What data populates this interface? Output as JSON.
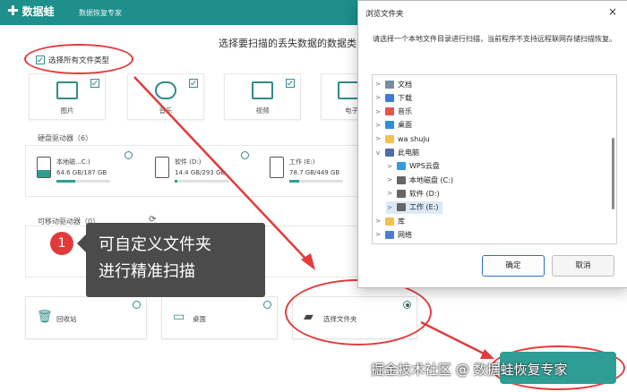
{
  "app": {
    "name": "数据蛙",
    "subtitle": "数据恢复专家"
  },
  "heading": "选择要扫描的丢失数据的数据类",
  "file_types": {
    "select_all_label": "选择所有文件类型",
    "items": [
      {
        "label": "图片",
        "icon": "image-icon"
      },
      {
        "label": "音乐",
        "icon": "music-icon"
      },
      {
        "label": "视频",
        "icon": "video-icon"
      },
      {
        "label": "电子",
        "icon": "document-icon"
      }
    ]
  },
  "drives": {
    "title": "硬盘驱动器（6）",
    "items": [
      {
        "name": "本地磁...C:)",
        "size": "64.6 GB/187 GB",
        "used_fraction": 0.35
      },
      {
        "name": "软件 (D:)",
        "size": "14.4 GB/293 GB",
        "used_fraction": 0.05
      },
      {
        "name": "工作 (E:)",
        "size": "78.7 GB/449 GB",
        "used_fraction": 0.18
      }
    ]
  },
  "removable": {
    "title": "可移动驱动器（0）"
  },
  "locations": [
    {
      "label": "回收站",
      "icon": "recycle-bin-icon"
    },
    {
      "label": "桌面",
      "icon": "desktop-icon"
    },
    {
      "label": "选择文件夹",
      "icon": "folder-icon",
      "selected": true
    }
  ],
  "callout": {
    "number": "1",
    "line1": "可自定义文件夹",
    "line2": "进行精准扫描"
  },
  "dialog": {
    "title": "浏览文件夹",
    "close": "×",
    "description": "请选择一个本地文件目录进行扫描，当前程序不支持远程联网存储扫描恢复。",
    "tree": [
      {
        "label": "文档",
        "icon": "documents-icon",
        "indent": 0,
        "expander": ">"
      },
      {
        "label": "下载",
        "icon": "download-icon",
        "indent": 0,
        "expander": ">"
      },
      {
        "label": "音乐",
        "icon": "music-icon",
        "indent": 0,
        "expander": ">"
      },
      {
        "label": "桌面",
        "icon": "desktop-icon",
        "indent": 0,
        "expander": ">"
      },
      {
        "label": "wa shuju",
        "icon": "folder-icon",
        "indent": 0,
        "expander": ">"
      },
      {
        "label": "此电脑",
        "icon": "computer-icon",
        "indent": 0,
        "expander": "v"
      },
      {
        "label": "WPS云盘",
        "icon": "cloud-icon",
        "indent": 1,
        "expander": ">"
      },
      {
        "label": "本地磁盘 (C:)",
        "icon": "drive-icon",
        "indent": 1,
        "expander": ">"
      },
      {
        "label": "软件 (D:)",
        "icon": "drive-icon",
        "indent": 1,
        "expander": ">"
      },
      {
        "label": "工作 (E:)",
        "icon": "drive-icon",
        "indent": 1,
        "expander": ">",
        "selected": true
      },
      {
        "label": "库",
        "icon": "library-icon",
        "indent": 0,
        "expander": ">"
      },
      {
        "label": "网络",
        "icon": "network-icon",
        "indent": 0,
        "expander": ">"
      }
    ],
    "ok": "确定",
    "cancel": "取消"
  },
  "watermark": "掘金技术社区 @ 数据蛙恢复专家",
  "colors": {
    "brand": "#1e8f8b",
    "annotation": "#e23b3b",
    "selection": "#dbe9f7"
  }
}
